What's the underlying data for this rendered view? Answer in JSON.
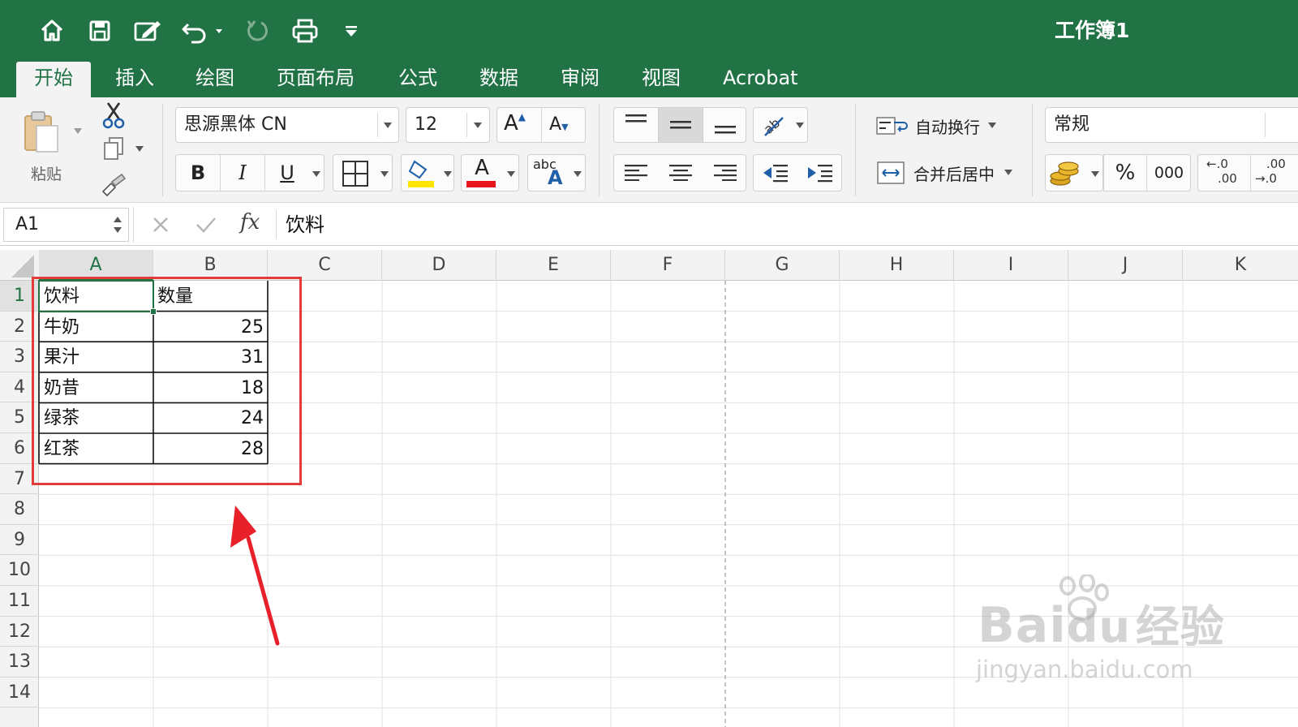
{
  "app": {
    "workbook_title": "工作簿1"
  },
  "quick_access": {
    "icons": [
      "home-icon",
      "save-icon",
      "edit-icon",
      "undo-icon",
      "redo-icon",
      "print-icon",
      "customize-icon"
    ]
  },
  "tabs": [
    {
      "label": "开始",
      "active": true
    },
    {
      "label": "插入",
      "active": false
    },
    {
      "label": "绘图",
      "active": false
    },
    {
      "label": "页面布局",
      "active": false
    },
    {
      "label": "公式",
      "active": false
    },
    {
      "label": "数据",
      "active": false
    },
    {
      "label": "审阅",
      "active": false
    },
    {
      "label": "视图",
      "active": false
    },
    {
      "label": "Acrobat",
      "active": false
    }
  ],
  "ribbon": {
    "paste_label": "粘贴",
    "font_name": "思源黑体 CN",
    "font_size": "12",
    "bold_label": "B",
    "italic_label": "I",
    "underline_label": "U",
    "grow_font_label": "A",
    "shrink_font_label": "A",
    "font_color_label": "A",
    "abc_label": "abc",
    "abc_a_label": "A",
    "wrap_text_label": "自动换行",
    "merge_center_label": "合并后居中",
    "number_format": "常规",
    "percent_label": "%",
    "thousands_label": "000",
    "dec_increase_top": "←.0",
    "dec_increase_bottom": ".00",
    "dec_decrease_top": ".00",
    "dec_decrease_bottom": "→.0",
    "fill_color": "#FFE600",
    "font_color": "#E8141C"
  },
  "formula_bar": {
    "name_box": "A1",
    "fx_label": "fx",
    "content": "饮料"
  },
  "sheet": {
    "columns": [
      "A",
      "B",
      "C",
      "D",
      "E",
      "F",
      "G",
      "H",
      "I",
      "J",
      "K"
    ],
    "rows": [
      "1",
      "2",
      "3",
      "4",
      "5",
      "6",
      "7",
      "8",
      "9",
      "10",
      "11",
      "12",
      "13",
      "14"
    ],
    "selected_cell": "A1",
    "table": [
      {
        "a": "饮料",
        "b": "数量"
      },
      {
        "a": "牛奶",
        "b": "25"
      },
      {
        "a": "果汁",
        "b": "31"
      },
      {
        "a": "奶昔",
        "b": "18"
      },
      {
        "a": "绿茶",
        "b": "24"
      },
      {
        "a": "红茶",
        "b": "28"
      }
    ]
  },
  "annotation": {
    "highlight_color": "#E23B3B",
    "arrow_color": "#E8202A"
  },
  "watermark": {
    "line1": "Bai",
    "line1b": "du",
    "line1c": "经验",
    "line2": "jingyan.baidu.com"
  }
}
